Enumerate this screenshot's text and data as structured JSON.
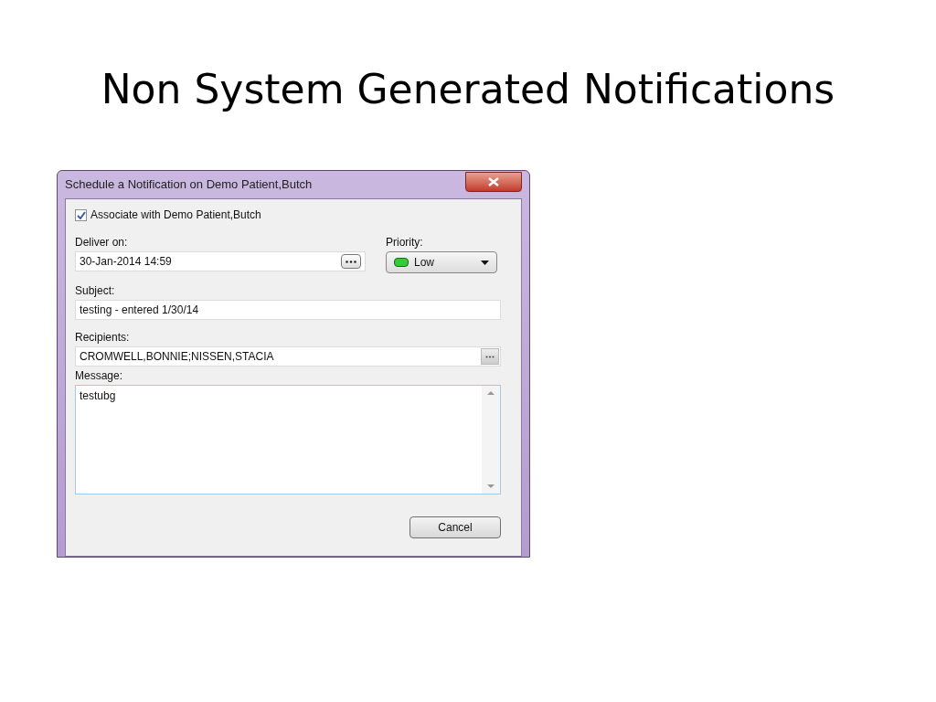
{
  "slide": {
    "title": "Non System Generated Notifications"
  },
  "window": {
    "title": "Schedule a Notification on Demo Patient,Butch"
  },
  "associate": {
    "label": "Associate with Demo Patient,Butch",
    "checked": true
  },
  "deliver_on": {
    "label": "Deliver on:",
    "value": "30-Jan-2014 14:59"
  },
  "priority": {
    "label": "Priority:",
    "value": "Low",
    "color": "#33cc33"
  },
  "subject": {
    "label": "Subject:",
    "value": "testing - entered 1/30/14"
  },
  "recipients": {
    "label": "Recipients:",
    "value": "CROMWELL,BONNIE;NISSEN,STACIA"
  },
  "message": {
    "label": "Message:",
    "value": "testubg"
  },
  "buttons": [
    "Cancel"
  ]
}
